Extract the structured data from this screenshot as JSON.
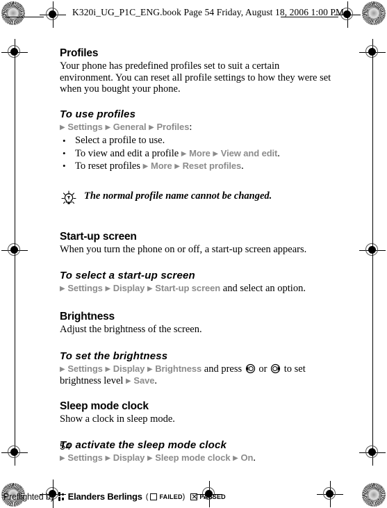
{
  "header": {
    "text": "K320i_UG_P1C_ENG.book  Page 54  Friday, August 18, 2006 1:00 PM"
  },
  "sections": [
    {
      "id": "profiles",
      "title": "Profiles",
      "body": "Your phone has predefined profiles set to suit a certain environment. You can reset all profile settings to how they were set when you bought your phone.",
      "subsection": {
        "title": "To use profiles",
        "path": [
          {
            "arrow": "▶",
            "label": "Settings"
          },
          {
            "arrow": "▶",
            "label": "General"
          },
          {
            "arrow": "▶",
            "label": "Profiles"
          }
        ],
        "path_suffix": ":",
        "bullets": [
          {
            "marker": "•",
            "parts": [
              {
                "type": "plain",
                "text": "Select a profile to use."
              }
            ]
          },
          {
            "marker": "•",
            "parts": [
              {
                "type": "plain",
                "text": "To view and edit a profile "
              },
              {
                "type": "arrow",
                "text": "▶"
              },
              {
                "type": "menu",
                "text": "More"
              },
              {
                "type": "arrow",
                "text": "▶"
              },
              {
                "type": "menu",
                "text": "View and edit"
              },
              {
                "type": "plain",
                "text": "."
              }
            ]
          },
          {
            "marker": "•",
            "parts": [
              {
                "type": "plain",
                "text": "To reset profiles "
              },
              {
                "type": "arrow",
                "text": "▶"
              },
              {
                "type": "menu",
                "text": "More"
              },
              {
                "type": "arrow",
                "text": "▶"
              },
              {
                "type": "menu",
                "text": "Reset profiles"
              },
              {
                "type": "plain",
                "text": "."
              }
            ]
          }
        ]
      },
      "tip": {
        "icon": "lightbulb-tip-icon",
        "text": "The normal profile name cannot be changed."
      }
    },
    {
      "id": "startup-screen",
      "title": "Start-up screen",
      "body": "When you turn the phone on or off, a start-up screen appears.",
      "subsection": {
        "title": "To select a start-up screen",
        "parts": [
          {
            "type": "arrow",
            "text": "▶"
          },
          {
            "type": "menu",
            "text": "Settings"
          },
          {
            "type": "arrow",
            "text": "▶"
          },
          {
            "type": "menu",
            "text": "Display"
          },
          {
            "type": "arrow",
            "text": "▶"
          },
          {
            "type": "menu",
            "text": "Start-up screen"
          },
          {
            "type": "plain",
            "text": " and select an option."
          }
        ]
      }
    },
    {
      "id": "brightness",
      "title": "Brightness",
      "body": "Adjust the brightness of the screen.",
      "subsection": {
        "title": "To set the brightness",
        "parts": [
          {
            "type": "arrow",
            "text": "▶"
          },
          {
            "type": "menu",
            "text": "Settings"
          },
          {
            "type": "arrow",
            "text": "▶"
          },
          {
            "type": "menu",
            "text": "Display"
          },
          {
            "type": "arrow",
            "text": "▶"
          },
          {
            "type": "menu",
            "text": "Brightness"
          },
          {
            "type": "plain",
            "text": " and press "
          },
          {
            "type": "icon",
            "icon": "nav-key-left-icon"
          },
          {
            "type": "plain",
            "text": " or "
          },
          {
            "type": "icon",
            "icon": "nav-key-right-icon"
          },
          {
            "type": "plain",
            "text": " to set brightness level "
          },
          {
            "type": "arrow",
            "text": "▶"
          },
          {
            "type": "menu",
            "text": "Save"
          },
          {
            "type": "plain",
            "text": "."
          }
        ]
      }
    },
    {
      "id": "sleep-mode-clock",
      "title": "Sleep mode clock",
      "body": "Show a clock in sleep mode.",
      "subsection": {
        "title": "To activate the sleep mode clock",
        "parts": [
          {
            "type": "arrow",
            "text": "▶"
          },
          {
            "type": "menu",
            "text": "Settings"
          },
          {
            "type": "arrow",
            "text": "▶"
          },
          {
            "type": "menu",
            "text": "Display"
          },
          {
            "type": "arrow",
            "text": "▶"
          },
          {
            "type": "menu",
            "text": "Sleep mode clock"
          },
          {
            "type": "arrow",
            "text": "▶"
          },
          {
            "type": "menu",
            "text": "On"
          },
          {
            "type": "plain",
            "text": "."
          }
        ]
      }
    }
  ],
  "page_number": "54",
  "footer": {
    "preflight_text": "Preflighted by",
    "company": "Elanders Berlings",
    "open_paren": "(",
    "failed_label": "FAILED",
    "close_paren": ")",
    "passed_label": "PASSED",
    "failed_checked": false,
    "passed_checked": true
  },
  "colors": {
    "menu_gray": "#8c8c8c",
    "text_black": "#000000",
    "page_background": "#ffffff"
  }
}
